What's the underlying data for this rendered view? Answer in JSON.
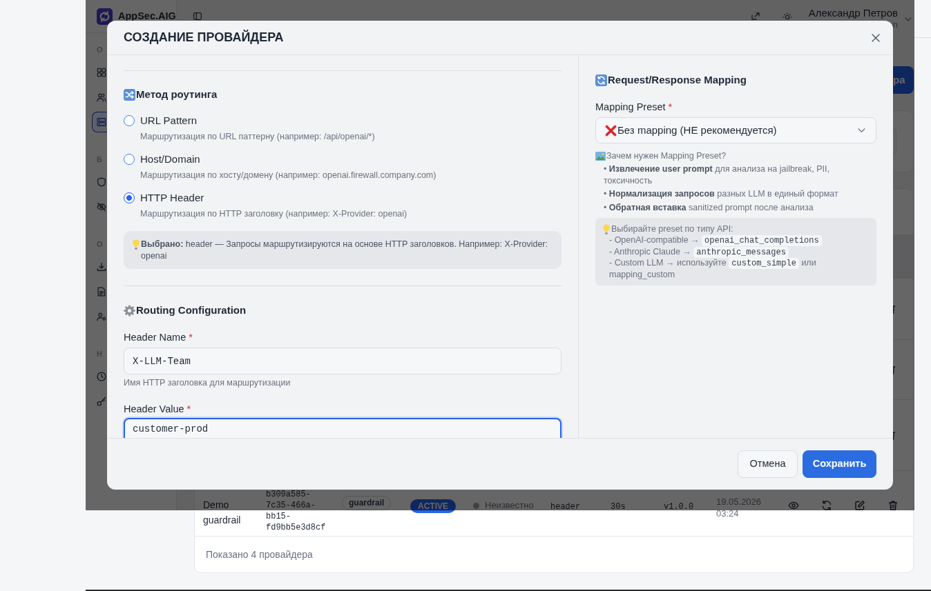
{
  "app": {
    "brand": "AppSec.AIG",
    "user": {
      "name": "Александр Петров",
      "role": "n"
    },
    "sidebar": {
      "sections": [
        {
          "label": "О",
          "items": [
            {
              "selected": false
            },
            {
              "selected": false
            },
            {
              "selected": true
            }
          ]
        },
        {
          "label": "Б",
          "items": [
            {
              "selected": false
            },
            {
              "selected": false
            }
          ]
        },
        {
          "label": "О",
          "items": [
            {
              "selected": false
            },
            {
              "selected": false
            },
            {
              "selected": false
            }
          ]
        },
        {
          "label": "Н",
          "items": [
            {
              "selected": false
            },
            {
              "selected": false
            }
          ]
        }
      ]
    },
    "add_button": {
      "label": "ра"
    },
    "table": {
      "rows": [
        {
          "name": "Demo guardrail",
          "id": "b309a585-7c35-466a-bb15-fd9bb5e3d8cf",
          "type": "guardrail",
          "status": "ACTIVE",
          "health": "Неизвестно",
          "routing": "header",
          "timeout": "30s",
          "version": "v1.0.0",
          "updated": "19.05.2026 03:24"
        }
      ],
      "footer": "Показано 4 провайдера"
    }
  },
  "modal": {
    "title": "СОЗДАНИЕ ПРОВАЙДЕРА",
    "routing": {
      "heading": "Метод роутинга",
      "options": [
        {
          "label": "URL Pattern",
          "description": "Маршрутизация по URL паттерну (например: /api/openai/*)",
          "selected": false
        },
        {
          "label": "Host/Domain",
          "description": "Маршрутизация по хосту/домену (например: openai.firewall.company.com)",
          "selected": false
        },
        {
          "label": "HTTP Header",
          "description": "Маршрутизация по HTTP заголовку (например: X-Provider: openai)",
          "selected": true
        }
      ],
      "note": "**Выбрано:** header — Запросы маршрутизируются на основе HTTP заголовков. Например: X-Provider: openai"
    },
    "config": {
      "heading": "Routing Configuration",
      "fields": [
        {
          "label": "Header Name",
          "required_mark": "*",
          "value": "X-LLM-Team",
          "help": "Имя HTTP заголовка для маршрутизации",
          "focused": false
        },
        {
          "label": "Header Value",
          "required_mark": "*",
          "value": "customer-prod",
          "focused": true
        }
      ]
    },
    "mapping": {
      "heading": "Request/Response Mapping",
      "label": "Mapping Preset",
      "required_mark": "*",
      "value": "Без mapping (НЕ рекомендуется)",
      "why": "Зачем нужен Mapping Preset?",
      "bullets": [
        "• **Извлечение user prompt** для анализа на jailbreak, PII, токсичность",
        "• **Нормализация запросов** разных LLM в единый формат",
        "• **Обратная вставка** sanitized prompt после анализа"
      ],
      "tip": {
        "title": "Выбирайте preset по типу API:",
        "lines": [
          [
            {
              "kind": "text",
              "text": "- OpenAI-compatible →"
            },
            {
              "kind": "code",
              "text": "openai_chat_completions"
            }
          ],
          [
            {
              "kind": "text",
              "text": "- Anthropic Claude →"
            },
            {
              "kind": "code",
              "text": "anthropic_messages"
            }
          ],
          [
            {
              "kind": "text",
              "text": "- Custom LLM → используйте"
            },
            {
              "kind": "code",
              "text": "custom_simple"
            },
            {
              "kind": "text",
              "text": "или mapping_custom"
            }
          ]
        ]
      }
    },
    "buttons": [
      {
        "label": "Отмена",
        "kind": "secondary"
      },
      {
        "label": "Сохранить",
        "kind": "primary"
      }
    ]
  }
}
